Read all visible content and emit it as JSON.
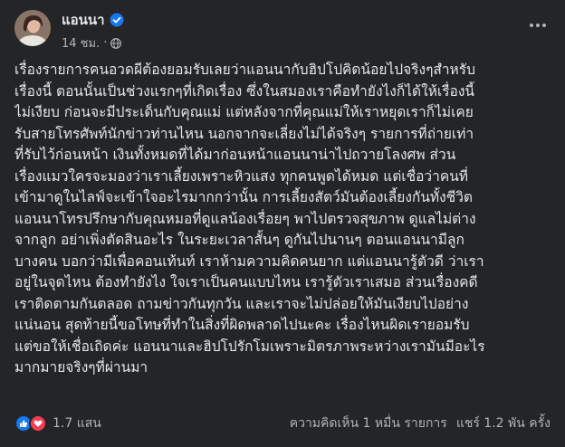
{
  "post": {
    "author": "แอนนา",
    "timestamp": "14 ชม.",
    "lines": [
      "เรื่องรายการคนอวดผีต้องยอมรับเลยว่าแอนนากับฮิปโปคิดน้อยไปจริงๆสำหรับ",
      "เรื่องนี้ ตอนนั้นเป็นช่วงแรกๆที่เกิดเรื่อง ซึ่งในสมองเราคือทำยังไงก็ได้ให้เรื่องนี้",
      "ไม่เงียบ ก่อนจะมีประเด็นกับคุณแม่ แต่หลังจากที่คุณแม่ให้เราหยุดเราก็ไม่เคย",
      "รับสายโทรศัพท์นักข่าวท่านไหน นอกจากจะเลี่ยงไม่ได้จริงๆ รายการที่ถ่ายเท่า",
      "ที่รับไว้ก่อนหน้า เงินทั้งหมดที่ได้มาก่อนหน้าแอนนาน่าไปถวายโลงศพ ส่วน",
      "เรื่องแมวใครจะมองว่าเราเลี้ยงเพราะหิวแสง ทุกคนพูดได้หมด แต่เชื่อว่าคนที่",
      "เข้ามาดูในไลฟ์จะเข้าใจอะไรมากกว่านั้น การเลี้ยงสัตว์มันต้องเลี้ยงกันทั้งชีวิต",
      "แอนนาโทรปรึกษากับคุณหมอที่ดูแลน้องเรื่อยๆ พาไปตรวจสุขภาพ ดูแลไม่ต่าง",
      "จากลูก อย่าเพิ่งตัดสินอะไร ในระยะเวลาสั้นๆ ดูกันไปนานๆ ตอนแอนนามีลูก",
      "บางคน บอกว่ามีเพื่อคอนเท้นท์ เราห้ามความคิดคนยาก แต่แอนนารู้ตัวดี  ว่าเรา",
      "อยู่ในจุดไหน ต้องทำยังไง ใจเราเป็นคนแบบไหน เรารู้ตัวเราเสมอ ส่วนเรื่องคดี",
      "เราติดตามกันตลอด ถามข่าวกันทุกวัน และเราจะไม่ปล่อยให้มันเงียบไปอย่าง",
      "แน่นอน สุดท้ายนี้ขอโทษที่ทำในสิ่งที่ผิดพลาดไปนะคะ เรื่องไหนผิดเรายอมรับ",
      "แต่ขอให้เชื่อเถิดค่ะ แอนนาและฮิปโปรักโมเพราะมิตรภาพระหว่างเรามันมีอะไร",
      "มากมายจริงๆที่ผ่านมา"
    ]
  },
  "footer": {
    "reaction_count": "1.7 แสน",
    "comments": "ความคิดเห็น 1 หมื่น รายการ",
    "shares": "แชร์ 1.2 พัน ครั้ง"
  },
  "icons": {
    "verified": "verified-badge-icon",
    "privacy": "globe-icon",
    "reactions": [
      "like-icon",
      "love-icon"
    ]
  },
  "colors": {
    "background": "#242526",
    "text": "#e4e6eb",
    "secondary_text": "#b0b3b8",
    "accent": "#1877f2",
    "love": "#f33e58"
  }
}
